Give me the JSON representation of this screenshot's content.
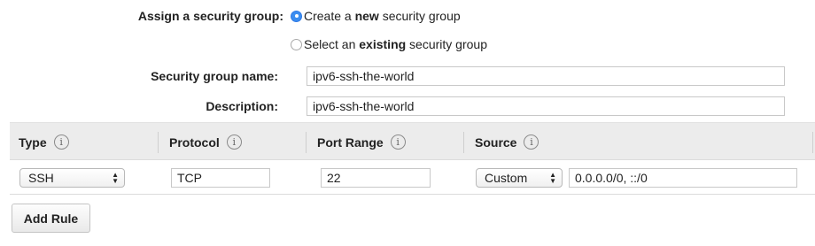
{
  "security_group": {
    "assign_label": "Assign a security group:",
    "options": [
      {
        "prefix": "Create a ",
        "bold": "new",
        "suffix": " security group",
        "selected": true
      },
      {
        "prefix": "Select an ",
        "bold": "existing",
        "suffix": " security group",
        "selected": false
      }
    ],
    "name_label": "Security group name:",
    "name_value": "ipv6-ssh-the-world",
    "description_label": "Description:",
    "description_value": "ipv6-ssh-the-world"
  },
  "rules_table": {
    "columns": [
      "Type",
      "Protocol",
      "Port Range",
      "Source"
    ],
    "info_icon_glyph": "i",
    "rows": [
      {
        "type": "SSH",
        "protocol": "TCP",
        "port_range": "22",
        "source_mode": "Custom",
        "source_value": "0.0.0.0/0, ::/0"
      }
    ],
    "select_arrows": "▲▼"
  },
  "add_rule_label": "Add Rule",
  "colors": {
    "accent": "#3b8df0",
    "header_bg": "#ececec"
  }
}
